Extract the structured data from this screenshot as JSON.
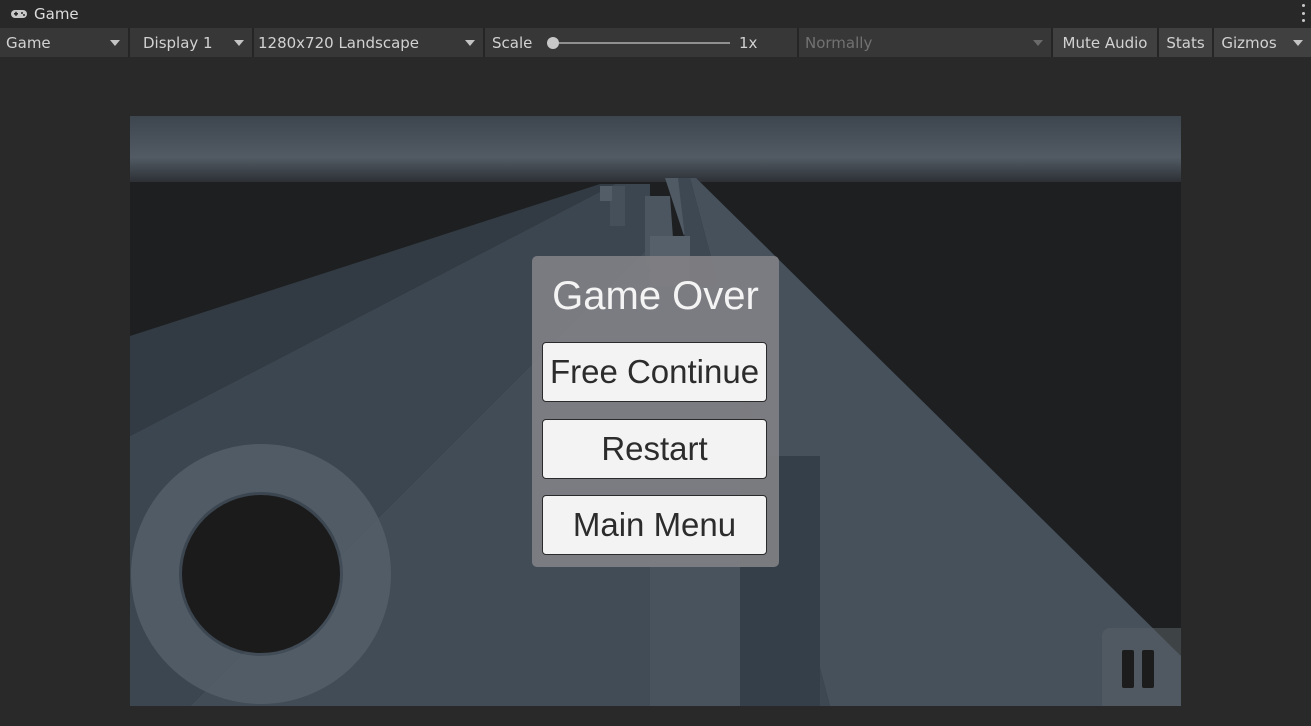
{
  "window": {
    "tab_title": "Game",
    "tab_icon": "gamepad-icon",
    "menu_icon": "kebab-menu-icon"
  },
  "toolbar": {
    "view_mode": "Game",
    "display": "Display 1",
    "resolution": "1280x720 Landscape",
    "scale_label": "Scale",
    "scale_value": "1x",
    "play_mode": "Normally",
    "mute_audio": "Mute Audio",
    "stats": "Stats",
    "gizmos": "Gizmos"
  },
  "game": {
    "panel_title": "Game Over",
    "buttons": [
      "Free Continue",
      "Restart",
      "Main Menu"
    ],
    "joystick_icon": "virtual-joystick",
    "pause_icon": "pause-icon"
  },
  "colors": {
    "panel": "#808084",
    "button_bg": "#f3f3f3",
    "road": "#3f4a55",
    "sky": "#434b53"
  }
}
